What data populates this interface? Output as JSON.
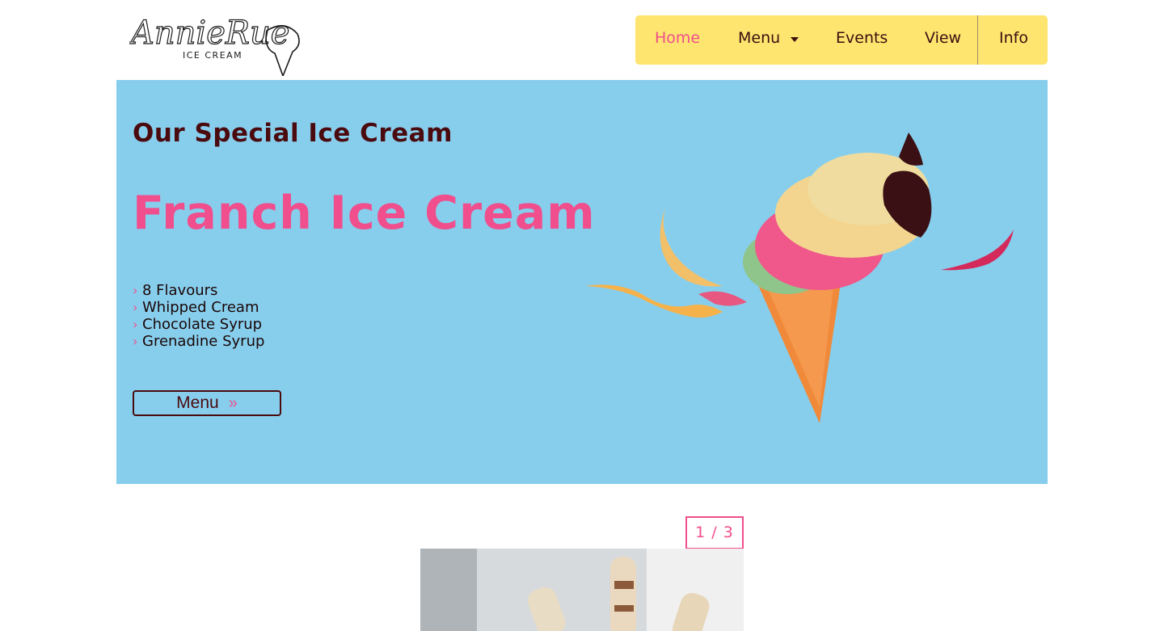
{
  "header": {
    "logo": {
      "script_text": "AnnieRue",
      "sub_text": "ICE CREAM",
      "icon": "ice-cream-cone-logo"
    }
  },
  "nav": {
    "items": [
      {
        "label": "Home",
        "active": true
      },
      {
        "label": "Menu",
        "has_dropdown": true,
        "icon": "caret-down-icon"
      },
      {
        "label": "Events"
      },
      {
        "label": "View"
      },
      {
        "label": "Info"
      }
    ],
    "background": "#fde56f",
    "active_color": "#f04e8c"
  },
  "hero": {
    "eyebrow": "Our Special Ice Cream",
    "title": "Franch Ice Cream",
    "features": [
      "8 Flavours",
      "Whipped Cream",
      "Chocolate Syrup",
      "Grenadine Syrup"
    ],
    "feature_icon": "chevron-right-icon",
    "button_label": "Menu",
    "button_icon": "double-chevron-right-icon",
    "background": "#87ceed",
    "title_color": "#f04e8c",
    "eyebrow_color": "#4a0a0e"
  },
  "slider": {
    "counter": "1 / 3"
  }
}
